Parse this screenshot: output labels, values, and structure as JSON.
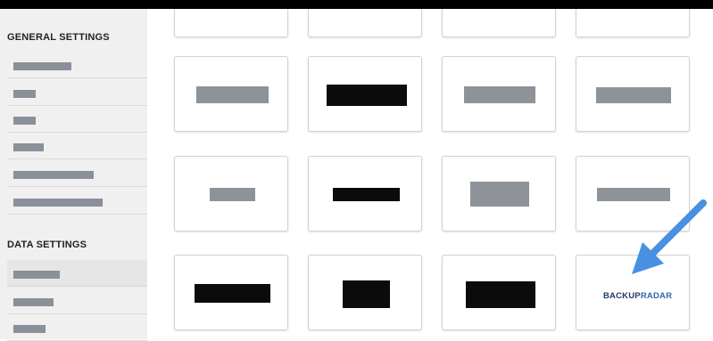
{
  "sidebar": {
    "sections": [
      {
        "title": "GENERAL SETTINGS"
      },
      {
        "title": "DATA SETTINGS"
      }
    ]
  },
  "tiles": {
    "backup_radar": {
      "word1": "BACKUP",
      "word2": "RADAR"
    }
  },
  "annotation": {
    "arrow_color": "#4a90e2",
    "target": "backup-radar-tile"
  }
}
